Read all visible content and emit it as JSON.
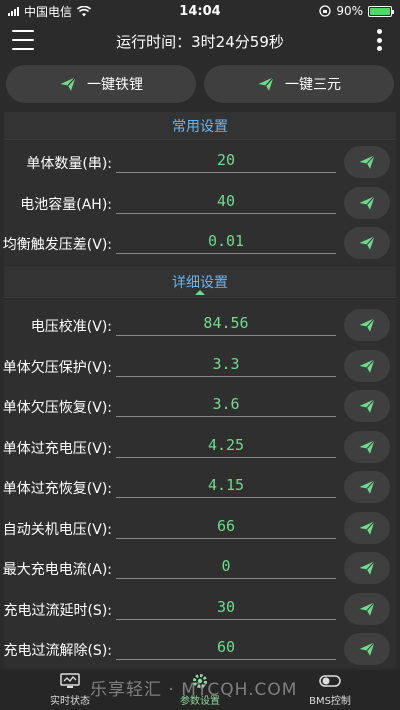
{
  "status_bar": {
    "carrier": "中国电信",
    "time": "14:04",
    "battery": "90%"
  },
  "header": {
    "title": "运行时间：3时24分59秒"
  },
  "quick_actions": {
    "lithium_iron": "一键铁锂",
    "ternary": "一键三元"
  },
  "common_settings": {
    "title": "常用设置",
    "rows": [
      {
        "label": "单体数量(串):",
        "value": "20"
      },
      {
        "label": "电池容量(AH):",
        "value": "40"
      },
      {
        "label": "均衡触发压差(V):",
        "value": "0.01"
      }
    ]
  },
  "detail_settings": {
    "title": "详细设置",
    "rows": [
      {
        "label": "电压校准(V):",
        "value": "84.56"
      },
      {
        "label": "单体欠压保护(V):",
        "value": "3.3"
      },
      {
        "label": "单体欠压恢复(V):",
        "value": "3.6"
      },
      {
        "label": "单体过充电压(V):",
        "value": "4.25"
      },
      {
        "label": "单体过充恢复(V):",
        "value": "4.15"
      },
      {
        "label": "自动关机电压(V):",
        "value": "66"
      },
      {
        "label": "最大充电电流(A):",
        "value": "0"
      },
      {
        "label": "充电过流延时(S):",
        "value": "30"
      },
      {
        "label": "充电过流解除(S):",
        "value": "60"
      }
    ]
  },
  "tabs": {
    "realtime": "实时状态",
    "params": "参数设置",
    "bms": "BMS控制"
  },
  "watermark": "乐享轻汇 · MYCQH.COM",
  "colors": {
    "accent_green": "#6fdc8c",
    "section_blue": "#6fb3e8",
    "background": "#2b2b2b"
  }
}
